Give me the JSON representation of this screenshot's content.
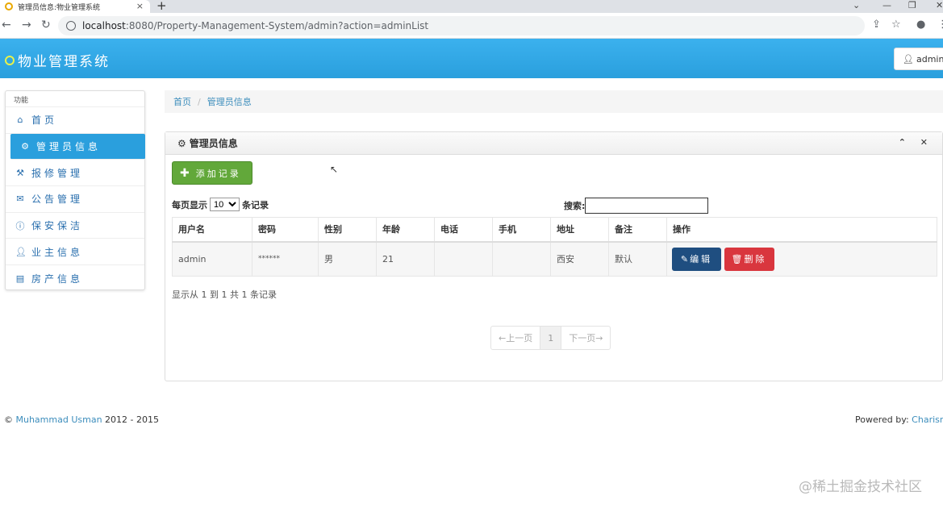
{
  "browser": {
    "tab_title": "管理员信息:物业管理系统",
    "tab_close": "×",
    "new_tab": "+",
    "url_host": "localhost",
    "url_path": ":8080/Property-Management-System/admin?action=adminList"
  },
  "header": {
    "brand": "物业管理系统",
    "user_label": "admin"
  },
  "sidebar": {
    "heading": "功能",
    "items": [
      {
        "label": "首页",
        "icon": "home-icon"
      },
      {
        "label": "管理员信息",
        "icon": "gear-icon"
      },
      {
        "label": "报修管理",
        "icon": "wrench-icon"
      },
      {
        "label": "公告管理",
        "icon": "envelope-icon"
      },
      {
        "label": "保安保洁",
        "icon": "info-icon"
      },
      {
        "label": "业主信息",
        "icon": "user-icon"
      },
      {
        "label": "房产信息",
        "icon": "book-icon"
      }
    ]
  },
  "breadcrumb": {
    "home": "首页",
    "current": "管理员信息"
  },
  "panel": {
    "title": "管理员信息",
    "add_button": "添加记录",
    "page_size_prefix": "每页显示",
    "page_size_value": "10",
    "page_size_suffix": "条记录",
    "search_label": "搜索:",
    "columns": [
      "用户名",
      "密码",
      "性别",
      "年龄",
      "电话",
      "手机",
      "地址",
      "备注",
      "操作"
    ],
    "rows": [
      {
        "username": "admin",
        "password": "******",
        "gender": "男",
        "age": "21",
        "phone": "",
        "mobile": "",
        "address": "西安",
        "note": "默认"
      }
    ],
    "edit_button": "编辑",
    "delete_button": "删除",
    "info_text": "显示从 1 到 1 共 1 条记录",
    "pager_prev": "←上一页",
    "pager_current": "1",
    "pager_next": "下一页→"
  },
  "footer": {
    "copyright_symbol": "©",
    "author": "Muhammad Usman",
    "years": "2012 - 2015",
    "powered_by": "Powered by:",
    "powered_link": "Charisma"
  },
  "watermark": "@稀土掘金技术社区"
}
